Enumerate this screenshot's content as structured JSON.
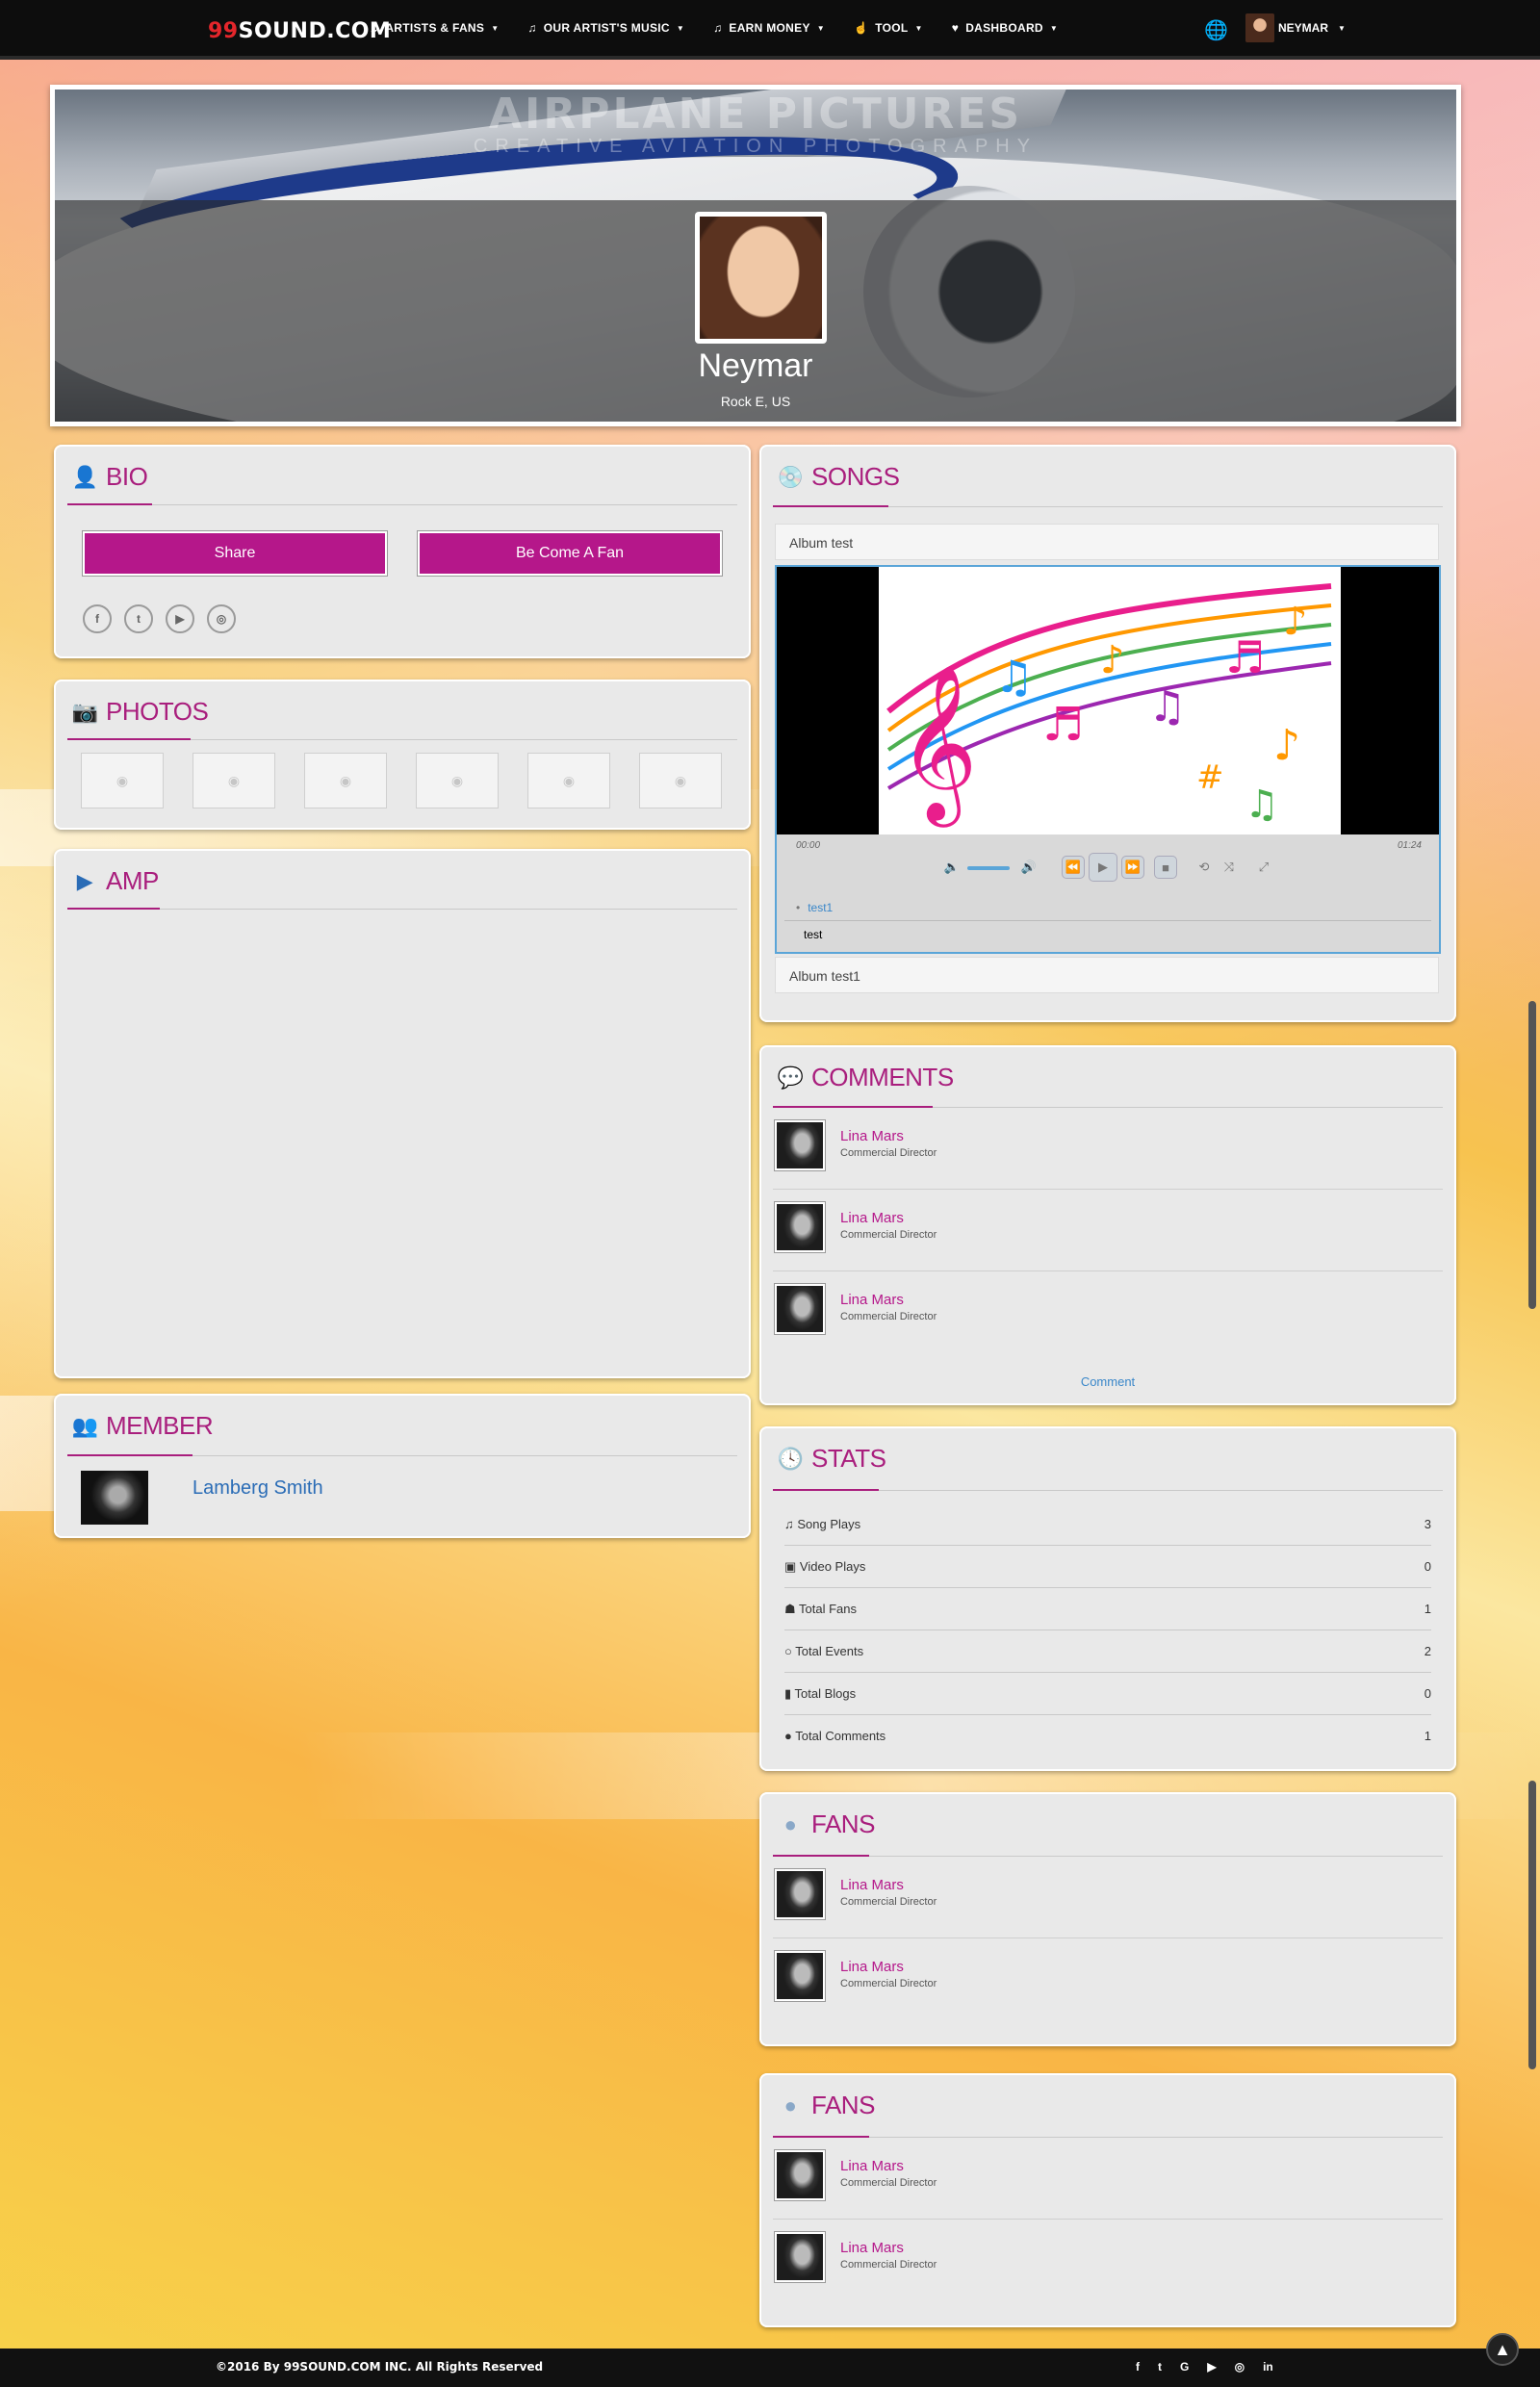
{
  "nav": {
    "logo_prefix": "99",
    "logo_rest": "SOUND.COM",
    "items": [
      {
        "label": "ARTISTS & FANS",
        "icon": "♫"
      },
      {
        "label": "OUR ARTIST'S MUSIC",
        "icon": "♫"
      },
      {
        "label": "EARN MONEY",
        "icon": "♫"
      },
      {
        "label": "TOOL",
        "icon": "☝"
      },
      {
        "label": "DASHBOARD",
        "icon": "♥"
      }
    ],
    "user_name": "NEYMAR"
  },
  "banner": {
    "watermark": "AIRPLANE PICTURES",
    "watermark_sub": "Creative Aviation Photography",
    "name": "Neymar",
    "location": "Rock E, US"
  },
  "bio": {
    "title": "BIO",
    "share_label": "Share",
    "fan_label": "Be Come A Fan",
    "socials": [
      "f",
      "t",
      "▶",
      "◎"
    ]
  },
  "photos": {
    "title": "PHOTOS"
  },
  "amp": {
    "title": "AMP"
  },
  "member": {
    "title": "MEMBER",
    "name": "Lamberg Smith"
  },
  "songs": {
    "title": "SONGS",
    "album_1": "Album test",
    "album_2": "Album test1",
    "time_start": "00:00",
    "time_end": "01:24",
    "playlist": [
      {
        "label": "test1"
      },
      {
        "label": "test"
      }
    ]
  },
  "comments": {
    "title": "COMMENTS",
    "items": [
      {
        "name": "Lina Mars",
        "role": "Commercial Director"
      },
      {
        "name": "Lina Mars",
        "role": "Commercial Director"
      },
      {
        "name": "Lina Mars",
        "role": "Commercial Director"
      }
    ],
    "link": "Comment"
  },
  "stats": {
    "title": "STATS",
    "rows": [
      {
        "icon": "♫",
        "label": "Song Plays",
        "value": "3"
      },
      {
        "icon": "▣",
        "label": "Video Plays",
        "value": "0"
      },
      {
        "icon": "☗",
        "label": "Total Fans",
        "value": "1"
      },
      {
        "icon": "○",
        "label": "Total Events",
        "value": "2"
      },
      {
        "icon": "▮",
        "label": "Total Blogs",
        "value": "0"
      },
      {
        "icon": "●",
        "label": "Total Comments",
        "value": "1"
      }
    ]
  },
  "fans_1": {
    "title": "FANS",
    "items": [
      {
        "name": "Lina Mars",
        "role": "Commercial Director"
      },
      {
        "name": "Lina Mars",
        "role": "Commercial Director"
      }
    ]
  },
  "fans_2": {
    "title": "FANS",
    "items": [
      {
        "name": "Lina Mars",
        "role": "Commercial Director"
      },
      {
        "name": "Lina Mars",
        "role": "Commercial Director"
      }
    ]
  },
  "footer": {
    "copyright": "©2016 By 99SOUND.COM INC. All Rights Reserved",
    "socials": [
      "f",
      "t",
      "G",
      "▶",
      "◎",
      "in"
    ]
  },
  "colors": {
    "accent": "#a91e7d",
    "button": "#b5178a",
    "link": "#3a87c9"
  }
}
